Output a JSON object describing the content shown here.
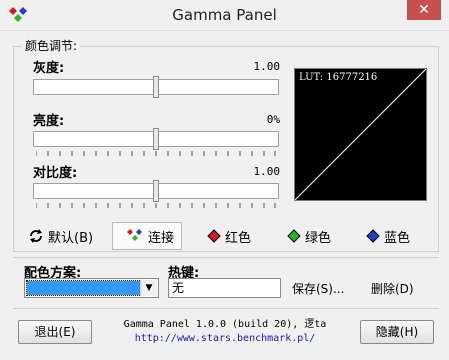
{
  "window": {
    "title": "Gamma Panel",
    "close_glyph": "✕"
  },
  "group_label": "颜色调节:",
  "sliders": [
    {
      "label": "灰度:",
      "value": "1.00"
    },
    {
      "label": "亮度:",
      "value": "0%"
    },
    {
      "label": "对比度:",
      "value": "1.00"
    }
  ],
  "lut_label": "LUT: 16777216",
  "channels": {
    "default": "默认(B)",
    "link": "连接",
    "red": "红色",
    "green": "绿色",
    "blue": "蓝色"
  },
  "scheme": {
    "label": "配色方案:",
    "selected": ""
  },
  "hotkey": {
    "label": "热键:",
    "value": "无"
  },
  "buttons": {
    "save": "保存(S)...",
    "delete": "删除(D)",
    "exit": "退出(E)",
    "hide": "隐藏(H)"
  },
  "footer": {
    "line1": "Gamma Panel 1.0.0 (build 20), 逻ta",
    "link": "http://www.stars.benchmark.pl/"
  },
  "colors": {
    "accent": "#3399ff",
    "red": "#d01f1f",
    "green": "#27b427",
    "blue": "#1d3fc4"
  }
}
